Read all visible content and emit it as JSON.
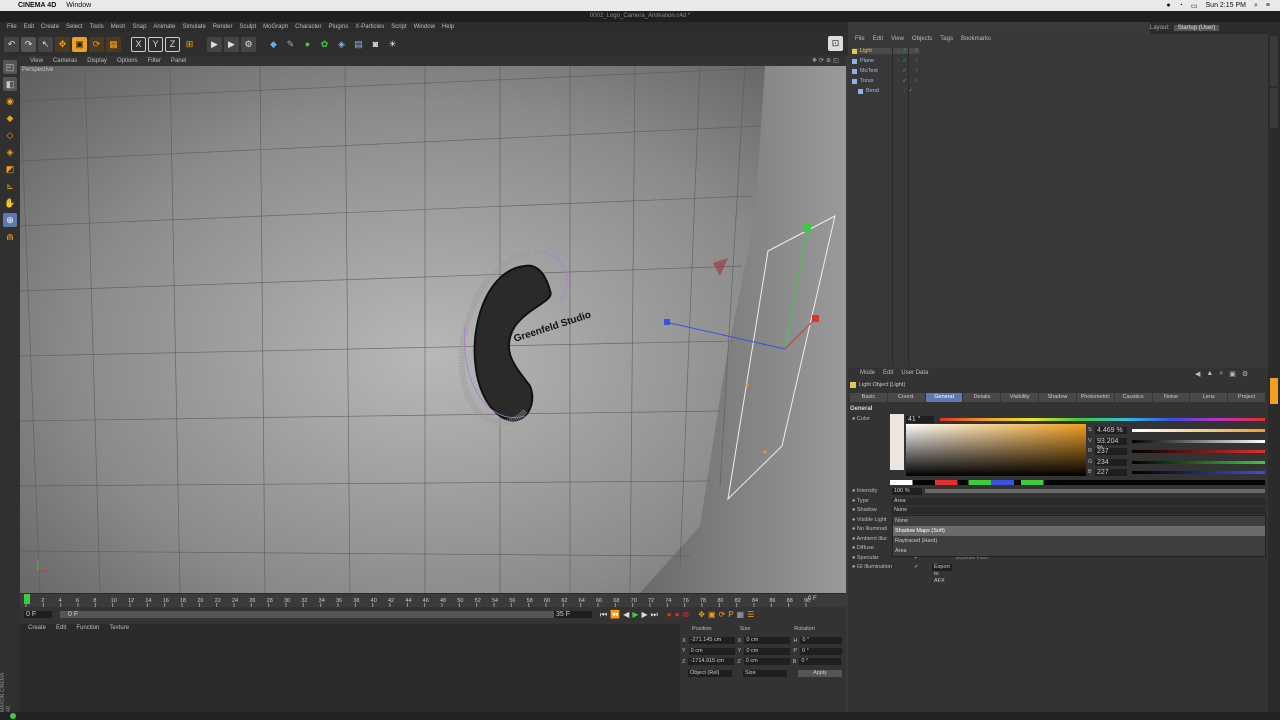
{
  "mac_menu": {
    "app": "CINEMA 4D",
    "window": "Window",
    "clock": "Sun 2:15 PM"
  },
  "window_title": "0002_Logo_Camera_Animation.c4d *",
  "c4d_menu": [
    "File",
    "Edit",
    "Create",
    "Select",
    "Tools",
    "Mesh",
    "Snap",
    "Animate",
    "Simulate",
    "Render",
    "Sculpt",
    "MoGraph",
    "Character",
    "Plugins",
    "X-Particles",
    "Script",
    "Window",
    "Help"
  ],
  "layout": {
    "label": "Layout:",
    "value": "Startup (User)"
  },
  "viewport_menu": [
    "View",
    "Cameras",
    "Display",
    "Options",
    "Filter",
    "Panel"
  ],
  "viewport_label": "Perspective",
  "logo_text": "Greenfeld Studio",
  "timeline": {
    "ticks": [
      "0",
      "2",
      "4",
      "6",
      "8",
      "10",
      "12",
      "14",
      "16",
      "18",
      "20",
      "22",
      "24",
      "26",
      "28",
      "30",
      "32",
      "34",
      "36",
      "38",
      "40",
      "42",
      "44",
      "46",
      "48",
      "50",
      "52",
      "54",
      "56",
      "58",
      "60",
      "62",
      "64",
      "66",
      "68",
      "70",
      "72",
      "74",
      "76",
      "78",
      "80",
      "82",
      "84",
      "86",
      "88",
      "90"
    ],
    "end_frame": "0 F",
    "start_field": "0 F",
    "start_field2": "0 F",
    "end_field": "35 F"
  },
  "material_menu": [
    "Create",
    "Edit",
    "Function",
    "Texture"
  ],
  "coords": {
    "headers": [
      "Position",
      "Size",
      "Rotation"
    ],
    "rows": [
      {
        "axis": "X",
        "pos": "-271.145 cm",
        "size_axis": "X",
        "size": "0 cm",
        "rot_axis": "H",
        "rot": "0 °"
      },
      {
        "axis": "Y",
        "pos": "0 cm",
        "size_axis": "Y",
        "size": "0 cm",
        "rot_axis": "P",
        "rot": "0 °"
      },
      {
        "axis": "Z",
        "pos": "-1714.915 cm",
        "size_axis": "Z",
        "size": "0 cm",
        "rot_axis": "B",
        "rot": "0 °"
      }
    ],
    "mode": "Object (Rel)",
    "size_mode": "Size",
    "apply": "Apply"
  },
  "object_menu": [
    "File",
    "Edit",
    "View",
    "Objects",
    "Tags",
    "Bookmarks"
  ],
  "objects": [
    {
      "name": "Light",
      "color": "#e8c550"
    },
    {
      "name": "Plane",
      "color": "#8fb3e0"
    },
    {
      "name": "MoText",
      "color": "#8fb3e0"
    },
    {
      "name": "Torus",
      "color": "#8fb3e0"
    },
    {
      "name": "Bend",
      "color": "#8fb3e0"
    }
  ],
  "attr_menu": [
    "Mode",
    "Edit",
    "User Data"
  ],
  "attr_object": "Light Object [Light]",
  "attr_tabs": [
    "Basic",
    "Coord.",
    "General",
    "Details",
    "Visibility",
    "Shadow",
    "Photometric",
    "Caustics",
    "Noise",
    "Lens",
    "Project"
  ],
  "active_tab": "General",
  "section": "General",
  "color_label": "Color",
  "hue_value": "41 °",
  "hsv": [
    {
      "k": "S",
      "v": "4.469 %"
    },
    {
      "k": "V",
      "v": "93.204 %"
    },
    {
      "k": "R",
      "v": "237"
    },
    {
      "k": "G",
      "v": "234"
    },
    {
      "k": "B",
      "v": "227"
    }
  ],
  "props": [
    {
      "label": "Intensity",
      "value": "100 %"
    },
    {
      "label": "Type",
      "value": "Area"
    },
    {
      "label": "Shadow",
      "value": "None"
    },
    {
      "label": "Visible Light",
      "value": ""
    },
    {
      "label": "No Illuminati",
      "value": ""
    },
    {
      "label": "Ambient Illur",
      "value": ""
    },
    {
      "label": "Diffuse",
      "value": ""
    },
    {
      "label": "Specular",
      "value": ""
    },
    {
      "label": "GI Illumination",
      "value": "Export to AFX"
    }
  ],
  "shadow_options": [
    "None",
    "Shadow Maps (Soft)",
    "Raytraced (Hard)",
    "Area"
  ],
  "shadow_highlight": "Shadow Maps (Soft)",
  "separate_pass": "Separate Pass",
  "colors": {
    "accent": "#5d7bb0",
    "light_yellow": "#e8c550",
    "axis_green": "#3ecb3e",
    "axis_red": "#e23030",
    "axis_blue": "#3a50e0"
  }
}
